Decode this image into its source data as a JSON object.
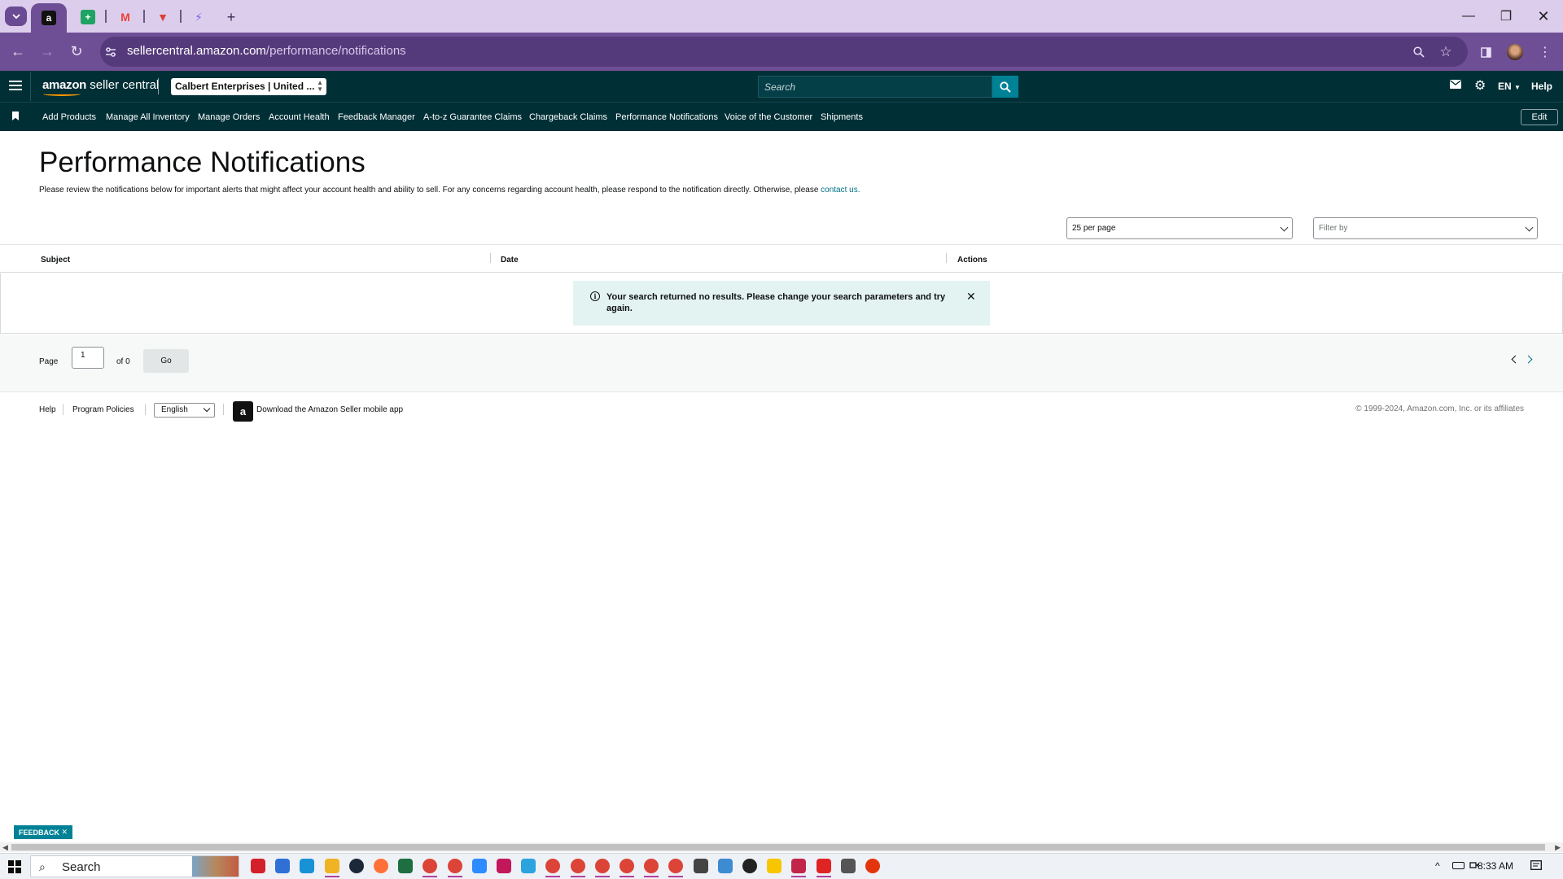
{
  "browser": {
    "tabs": [
      {
        "name": "amazon",
        "icon": "a",
        "color": "#111111"
      },
      {
        "name": "sheets",
        "icon": "+",
        "color": "#1ea362"
      },
      {
        "name": "gmail",
        "icon": "M",
        "color": "#ea4335"
      },
      {
        "name": "todoist",
        "icon": "▼",
        "color": "#db4035"
      },
      {
        "name": "clickup",
        "icon": "⚡",
        "color": "#7b68ee"
      }
    ],
    "url_host": "sellercentral.amazon.com",
    "url_path": "/performance/notifications"
  },
  "header": {
    "logo_brand": "amazon",
    "logo_product": "seller central",
    "account": "Calbert Enterprises | United ...",
    "search_placeholder": "Search",
    "language": "EN",
    "help": "Help"
  },
  "nav": {
    "links": [
      "Add Products",
      "Manage All Inventory",
      "Manage Orders",
      "Account Health",
      "Feedback Manager",
      "A-to-z Guarantee Claims",
      "Chargeback Claims",
      "Performance Notifications",
      "Voice of the Customer",
      "Shipments"
    ],
    "edit": "Edit"
  },
  "page": {
    "title": "Performance Notifications",
    "description": "Please review the notifications below for important alerts that might affect your account health and ability to sell. For any concerns regarding account health, please respond to the notification directly. Otherwise, please ",
    "contact_link": "contact us.",
    "per_page": "25 per page",
    "filter_placeholder": "Filter by"
  },
  "table": {
    "columns": [
      "Subject",
      "Date",
      "Actions"
    ],
    "empty_message": "Your search returned no results. Please change your search parameters and try again."
  },
  "pagination": {
    "page_label": "Page",
    "current_page": "1",
    "of_label": "of 0",
    "go": "Go"
  },
  "footer": {
    "help": "Help",
    "program_policies": "Program Policies",
    "language": "English",
    "app_download": "Download the Amazon Seller mobile app",
    "copyright": "© 1999-2024, Amazon.com, Inc. or its affiliates"
  },
  "feedback": "FEEDBACK",
  "taskbar": {
    "search": "Search",
    "time": "8:33 AM",
    "apps": [
      {
        "name": "app-red-circle",
        "color": "#d3202a"
      },
      {
        "name": "app-blue-square",
        "color": "#2f6fd6"
      },
      {
        "name": "edge",
        "color": "#1792d6"
      },
      {
        "name": "file-explorer",
        "color": "#f0b323"
      },
      {
        "name": "steam",
        "color": "#1b2838"
      },
      {
        "name": "firefox",
        "color": "#ff7139"
      },
      {
        "name": "excel",
        "color": "#1d6f42"
      },
      {
        "name": "chrome",
        "color": "#db4437"
      },
      {
        "name": "chrome",
        "color": "#db4437"
      },
      {
        "name": "zoom",
        "color": "#2d8cff"
      },
      {
        "name": "app-pink",
        "color": "#c2185b"
      },
      {
        "name": "telegram",
        "color": "#2aa3df"
      },
      {
        "name": "chrome",
        "color": "#db4437"
      },
      {
        "name": "chrome",
        "color": "#db4437"
      },
      {
        "name": "chrome",
        "color": "#db4437"
      },
      {
        "name": "chrome",
        "color": "#db4437"
      },
      {
        "name": "chrome",
        "color": "#db4437"
      },
      {
        "name": "chrome",
        "color": "#db4437"
      },
      {
        "name": "calculator",
        "color": "#444444"
      },
      {
        "name": "notepad",
        "color": "#3d8bd0"
      },
      {
        "name": "obs",
        "color": "#222222"
      },
      {
        "name": "sticky-notes",
        "color": "#f7c600"
      },
      {
        "name": "snipping-tool",
        "color": "#c1264a"
      },
      {
        "name": "app-red-logo",
        "color": "#e02424"
      },
      {
        "name": "settings",
        "color": "#555555"
      },
      {
        "name": "pokeball",
        "color": "#e3350d"
      }
    ]
  }
}
